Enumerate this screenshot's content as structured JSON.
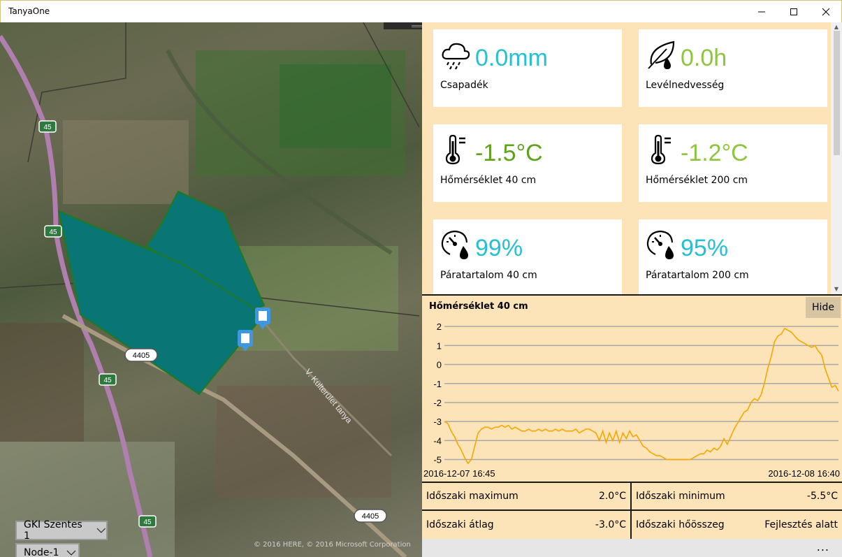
{
  "window": {
    "title": "TanyaOne"
  },
  "map": {
    "attribution": "© 2016 HERE, © 2016 Microsoft Corporation",
    "road_labels": [
      "45",
      "45",
      "45",
      "45",
      "4405",
      "4405"
    ],
    "street_label": "V. Külterület tanya",
    "station_dropdown": "GKI Szentes 1",
    "node_dropdown": "Node-1",
    "field_color": "#0a7575"
  },
  "tiles": [
    {
      "value": "0.0mm",
      "label": "Csapadék",
      "icon": "rain-cloud-icon",
      "color": "#26c0d3"
    },
    {
      "value": "0.0h",
      "label": "Levélnedvesség",
      "icon": "leaf-drop-icon",
      "color": "#8cc63f"
    },
    {
      "value": "-1.5°C",
      "label": "Hőmérséklet 40 cm",
      "icon": "thermometer-icon",
      "color": "#5fa31a"
    },
    {
      "value": "-1.2°C",
      "label": "Hőmérséklet 200 cm",
      "icon": "thermometer-icon",
      "color": "#8cc63f"
    },
    {
      "value": "99%",
      "label": "Páratartalom 40 cm",
      "icon": "humidity-gauge-icon",
      "color": "#26c0d3"
    },
    {
      "value": "95%",
      "label": "Páratartalom 200 cm",
      "icon": "humidity-gauge-icon",
      "color": "#26c0d3"
    }
  ],
  "chart": {
    "title": "Hőmérséklet 40 cm",
    "hide_label": "Hide",
    "x_start_label": "2016-12-07 16:45",
    "x_end_label": "2016-12-08 16:40"
  },
  "chart_data": {
    "type": "line",
    "title": "Hőmérséklet 40 cm",
    "xlabel": "",
    "ylabel": "",
    "ylim": [
      -5.2,
      2.3
    ],
    "y_ticks": [
      2,
      1,
      0,
      -1,
      -2,
      -3,
      -4,
      -5
    ],
    "x_tick_labels": [
      "2016-12-07 16:45",
      "2016-12-08 16:40"
    ],
    "grid": true,
    "color": "#f5a800",
    "series": [
      {
        "values": [
          -3.0,
          -3.1,
          -3.5,
          -3.8,
          -4.2,
          -4.5,
          -4.9,
          -5.2,
          -5.0,
          -4.3,
          -3.6,
          -3.4,
          -3.3,
          -3.3,
          -3.4,
          -3.3,
          -3.3,
          -3.2,
          -3.3,
          -3.2,
          -3.4,
          -3.3,
          -3.4,
          -3.5,
          -3.5,
          -3.4,
          -3.5,
          -3.5,
          -3.4,
          -3.5,
          -3.4,
          -3.5,
          -3.5,
          -3.4,
          -3.5,
          -3.4,
          -3.5,
          -3.5,
          -3.5,
          -3.4,
          -3.6,
          -3.5,
          -3.4,
          -3.4,
          -3.5,
          -3.6,
          -4.0,
          -3.5,
          -4.1,
          -3.6,
          -4.0,
          -3.5,
          -4.1,
          -3.6,
          -3.9,
          -3.5,
          -3.8,
          -3.7,
          -4.0,
          -4.3,
          -4.4,
          -4.6,
          -4.7,
          -4.8,
          -4.8,
          -4.9,
          -5.0,
          -5.0,
          -5.0,
          -5.0,
          -5.0,
          -5.0,
          -5.0,
          -5.0,
          -4.9,
          -4.8,
          -4.7,
          -4.7,
          -4.5,
          -4.6,
          -4.4,
          -4.5,
          -4.3,
          -3.9,
          -4.2,
          -3.8,
          -3.4,
          -3.1,
          -2.8,
          -2.5,
          -2.4,
          -2.0,
          -1.8,
          -1.9,
          -1.6,
          -1.0,
          -0.2,
          0.4,
          1.2,
          1.5,
          1.6,
          1.9,
          1.8,
          1.7,
          1.5,
          1.3,
          1.2,
          1.1,
          1.0,
          0.9,
          1.0,
          0.7,
          0.5,
          -0.2,
          -0.7,
          -1.2,
          -1.1,
          -1.4
        ]
      }
    ]
  },
  "stats": [
    {
      "label": "Időszaki maximum",
      "value": "2.0°C"
    },
    {
      "label": "Időszaki minimum",
      "value": "-5.5°C"
    },
    {
      "label": "Időszaki átlag",
      "value": "-3.0°C"
    },
    {
      "label": "Időszaki hőösszeg",
      "value": "Fejlesztés alatt"
    }
  ],
  "appbar": {
    "more_label": "..."
  }
}
